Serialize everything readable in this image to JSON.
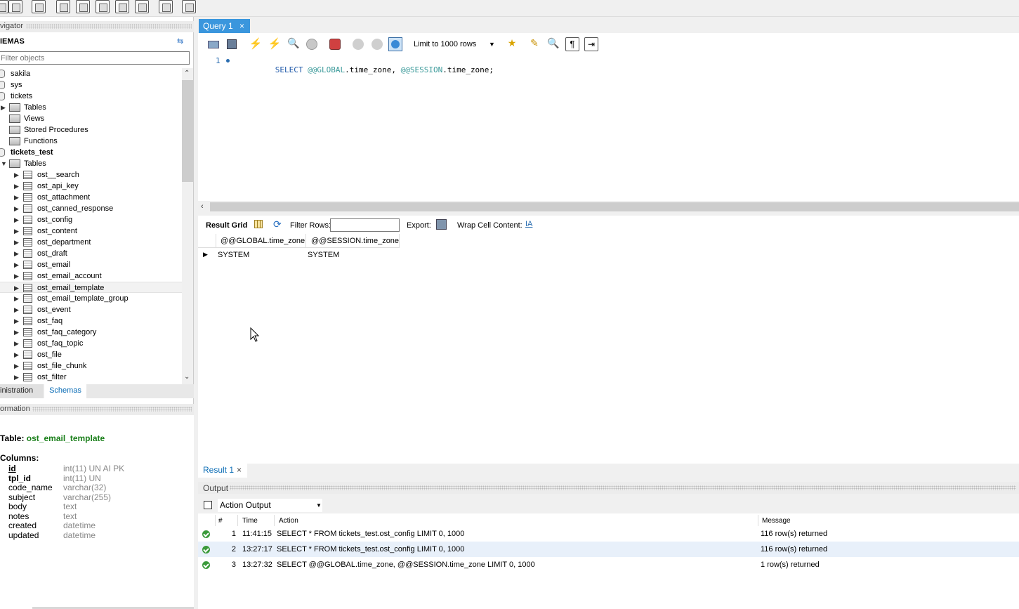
{
  "navigator": {
    "title": "vigator",
    "schemas_label": "IEMAS",
    "filter_placeholder": "Filter objects",
    "tree": [
      {
        "label": "sakila",
        "kind": "db",
        "bold": false
      },
      {
        "label": "sys",
        "kind": "db",
        "bold": false
      },
      {
        "label": "tickets",
        "kind": "db",
        "bold": false
      },
      {
        "label": "Tables",
        "kind": "folder",
        "arrow": "▶"
      },
      {
        "label": "Views",
        "kind": "folder",
        "arrow": ""
      },
      {
        "label": "Stored Procedures",
        "kind": "folder",
        "arrow": ""
      },
      {
        "label": "Functions",
        "kind": "folder",
        "arrow": ""
      },
      {
        "label": "tickets_test",
        "kind": "db",
        "bold": true
      },
      {
        "label": "Tables",
        "kind": "folder",
        "arrow": "▼"
      }
    ],
    "tables": [
      "ost__search",
      "ost_api_key",
      "ost_attachment",
      "ost_canned_response",
      "ost_config",
      "ost_content",
      "ost_department",
      "ost_draft",
      "ost_email",
      "ost_email_account",
      "ost_email_template",
      "ost_email_template_group",
      "ost_event",
      "ost_faq",
      "ost_faq_category",
      "ost_faq_topic",
      "ost_file",
      "ost_file_chunk",
      "ost_filter"
    ],
    "selected_table": "ost_email_template",
    "bottom_tabs": [
      "inistration",
      "Schemas"
    ]
  },
  "info": {
    "title": "ormation",
    "table_label": "Table:",
    "table_name": "ost_email_template",
    "columns_label": "Columns:",
    "columns": [
      {
        "name": "id",
        "type": "int(11) UN AI PK",
        "key": true
      },
      {
        "name": "tpl_id",
        "type": "int(11) UN",
        "key": true
      },
      {
        "name": "code_name",
        "type": "varchar(32)",
        "key": false
      },
      {
        "name": "subject",
        "type": "varchar(255)",
        "key": false
      },
      {
        "name": "body",
        "type": "text",
        "key": false
      },
      {
        "name": "notes",
        "type": "text",
        "key": false
      },
      {
        "name": "created",
        "type": "datetime",
        "key": false
      },
      {
        "name": "updated",
        "type": "datetime",
        "key": false
      }
    ]
  },
  "query_tab": {
    "label": "Query 1",
    "close": "×"
  },
  "editor": {
    "limit_label": "Limit to 1000 rows",
    "line_number": "1",
    "sql_keyword": "SELECT",
    "sql_var1": "@@GLOBAL",
    "sql_part1": ".time_zone, ",
    "sql_var2": "@@SESSION",
    "sql_part2": ".time_zone;"
  },
  "result_toolbar": {
    "grid_label": "Result Grid",
    "filter_label": "Filter Rows:",
    "export_label": "Export:",
    "wrap_label": "Wrap Cell Content:"
  },
  "result_grid": {
    "headers": [
      "@@GLOBAL.time_zone",
      "@@SESSION.time_zone"
    ],
    "row": [
      "SYSTEM",
      "SYSTEM"
    ]
  },
  "result_tab": {
    "label": "Result 1",
    "close": "×"
  },
  "output": {
    "title": "Output",
    "select_value": "Action Output",
    "headers": {
      "num": "#",
      "time": "Time",
      "action": "Action",
      "message": "Message"
    },
    "rows": [
      {
        "num": "1",
        "time": "11:41:15",
        "action": "SELECT * FROM tickets_test.ost_config LIMIT 0, 1000",
        "message": "116 row(s) returned"
      },
      {
        "num": "2",
        "time": "13:27:17",
        "action": "SELECT * FROM tickets_test.ost_config LIMIT 0, 1000",
        "message": "116 row(s) returned"
      },
      {
        "num": "3",
        "time": "13:27:32",
        "action": "SELECT @@GLOBAL.time_zone, @@SESSION.time_zone LIMIT 0, 1000",
        "message": "1 row(s) returned"
      }
    ]
  },
  "colors": {
    "accent": "#0a6cb5",
    "green_name": "#1a7f1a",
    "sql_keyword": "#1c57a8",
    "sql_var": "#3b9a9a"
  }
}
